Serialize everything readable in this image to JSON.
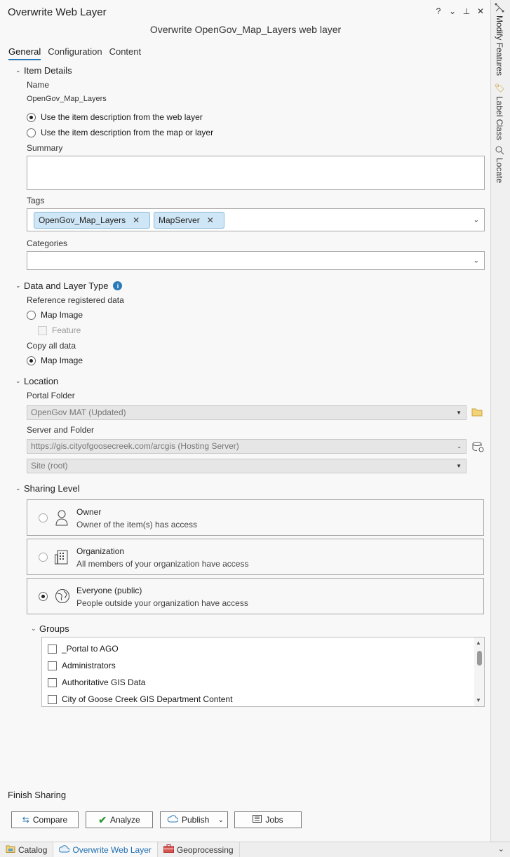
{
  "pane": {
    "title": "Overwrite Web Layer",
    "subtitle": "Overwrite OpenGov_Map_Layers web layer",
    "controls": {
      "help": "?",
      "menu": "⌄",
      "pin": "⊥",
      "close": "✕"
    }
  },
  "tabs": [
    {
      "label": "General",
      "active": true
    },
    {
      "label": "Configuration",
      "active": false
    },
    {
      "label": "Content",
      "active": false
    }
  ],
  "item_details": {
    "header": "Item Details",
    "name_label": "Name",
    "name_value": "OpenGov_Map_Layers",
    "desc_option_1": "Use the item description from the web layer",
    "desc_option_2": "Use the item description from the map or layer",
    "selected_desc_option": 1,
    "summary_label": "Summary",
    "summary_value": "",
    "tags_label": "Tags",
    "tags": [
      "OpenGov_Map_Layers",
      "MapServer"
    ],
    "categories_label": "Categories",
    "categories_value": ""
  },
  "data_layer_type": {
    "header": "Data and Layer Type",
    "reference_label": "Reference registered data",
    "ref_map_image": "Map Image",
    "ref_feature": "Feature",
    "copy_label": "Copy all data",
    "copy_map_image": "Map Image"
  },
  "location": {
    "header": "Location",
    "portal_folder_label": "Portal Folder",
    "portal_folder_value": "OpenGov MAT (Updated)",
    "server_folder_label": "Server and Folder",
    "server_value": "https://gis.cityofgoosecreek.com/arcgis (Hosting Server)",
    "folder_value": "Site (root)"
  },
  "sharing": {
    "header": "Sharing Level",
    "options": [
      {
        "title": "Owner",
        "desc": "Owner of the item(s) has access",
        "selected": false
      },
      {
        "title": "Organization",
        "desc": "All members of your organization have access",
        "selected": false
      },
      {
        "title": "Everyone (public)",
        "desc": "People outside your organization have access",
        "selected": true
      }
    ],
    "groups_header": "Groups",
    "groups": [
      "_Portal to AGO",
      "Administrators",
      "Authoritative GIS Data",
      "City of Goose Creek GIS Department Content"
    ]
  },
  "finish": {
    "header": "Finish Sharing",
    "compare": "Compare",
    "analyze": "Analyze",
    "publish": "Publish",
    "jobs": "Jobs"
  },
  "side_tabs": [
    "Modify Features",
    "Label Class",
    "Locate"
  ],
  "bottom_tabs": [
    {
      "label": "Catalog",
      "active": false
    },
    {
      "label": "Overwrite Web Layer",
      "active": true
    },
    {
      "label": "Geoprocessing",
      "active": false
    }
  ],
  "colors": {
    "accent": "#2a7ab8",
    "tag_bg": "#cfe6f7",
    "analyze_check": "#2e9b3a"
  }
}
